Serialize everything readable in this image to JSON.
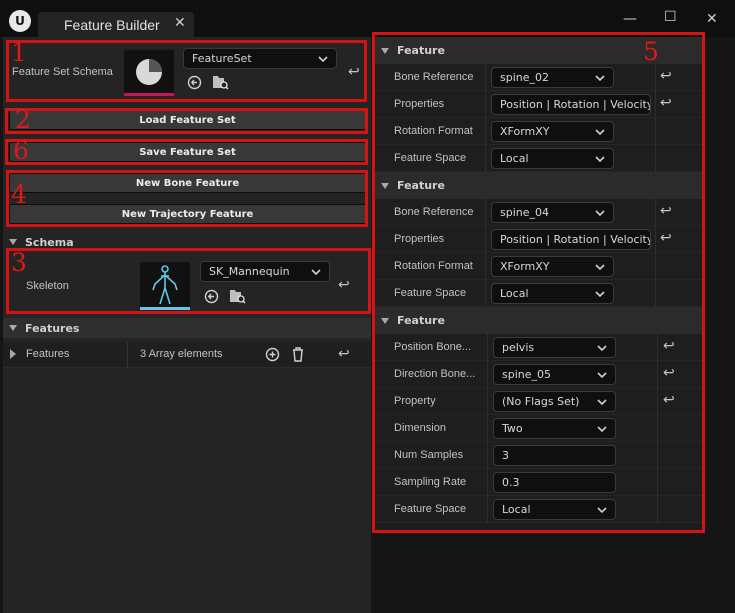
{
  "window": {
    "tab_title": "Feature Builder",
    "logo_text": "U"
  },
  "left": {
    "feature_set_schema_label": "Feature Set Schema",
    "feature_set_value": "FeatureSet",
    "load_button": "Load Feature Set",
    "save_button": "Save Feature Set",
    "new_bone_feature": "New Bone Feature",
    "new_trajectory_feature": "New Trajectory Feature",
    "schema_header": "Schema",
    "skeleton_label": "Skeleton",
    "skeleton_value": "SK_Mannequin",
    "features_header": "Features",
    "features_label": "Features",
    "features_count": "3 Array elements"
  },
  "right": {
    "features": [
      {
        "header": "Feature",
        "rows": [
          {
            "label": "Bone Reference",
            "value": "spine_02",
            "type": "combo"
          },
          {
            "label": "Properties",
            "value": "Position | Rotation | Velocity",
            "type": "combo"
          },
          {
            "label": "Rotation Format",
            "value": "XFormXY",
            "type": "combo"
          },
          {
            "label": "Feature Space",
            "value": "Local",
            "type": "combo"
          }
        ]
      },
      {
        "header": "Feature",
        "rows": [
          {
            "label": "Bone Reference",
            "value": "spine_04",
            "type": "combo"
          },
          {
            "label": "Properties",
            "value": "Position | Rotation | Velocity",
            "type": "combo"
          },
          {
            "label": "Rotation Format",
            "value": "XFormXY",
            "type": "combo"
          },
          {
            "label": "Feature Space",
            "value": "Local",
            "type": "combo"
          }
        ]
      },
      {
        "header": "Feature",
        "rows": [
          {
            "label": "Position Bone...",
            "value": "pelvis",
            "type": "combo"
          },
          {
            "label": "Direction Bone...",
            "value": "spine_05",
            "type": "combo"
          },
          {
            "label": "Property",
            "value": "(No Flags Set)",
            "type": "combo"
          },
          {
            "label": "Dimension",
            "value": "Two",
            "type": "combo"
          },
          {
            "label": "Num Samples",
            "value": "3",
            "type": "text"
          },
          {
            "label": "Sampling Rate",
            "value": "0.3",
            "type": "text"
          },
          {
            "label": "Feature Space",
            "value": "Local",
            "type": "combo"
          }
        ]
      }
    ]
  },
  "annotations": {
    "m1": "1",
    "m2": "2",
    "m3": "3",
    "m4": "4",
    "m5": "5",
    "m6": "6",
    "color": "#d41414"
  },
  "colors": {
    "accent_cyan": "#5ec8e6",
    "background": "#151515",
    "panel": "#242424"
  }
}
